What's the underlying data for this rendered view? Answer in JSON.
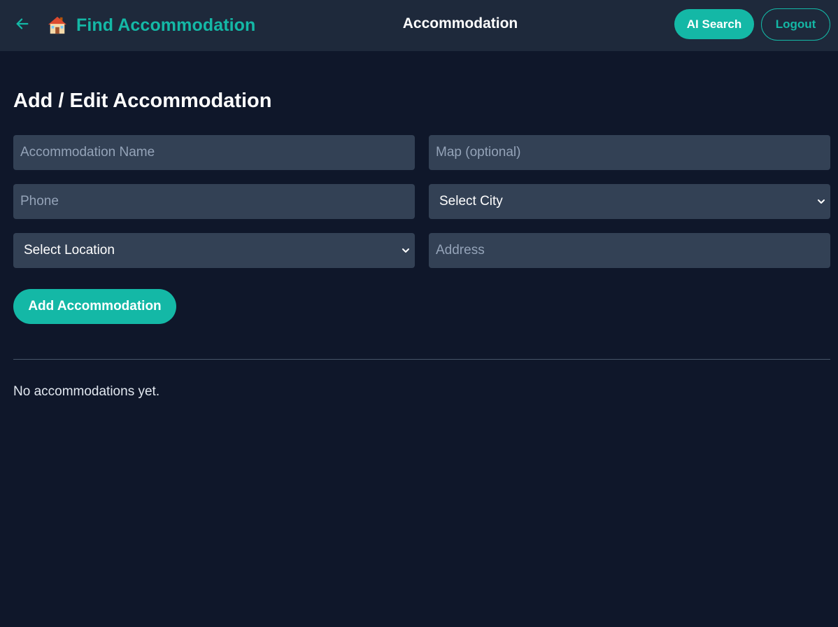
{
  "header": {
    "brand_title": "Find Accommodation",
    "page_title": "Accommodation",
    "ai_search_label": "AI Search",
    "logout_label": "Logout",
    "brand_icon": "house-icon",
    "back_icon": "arrow-left-icon"
  },
  "form": {
    "heading": "Add / Edit Accommodation",
    "name_placeholder": "Accommodation Name",
    "map_placeholder": "Map (optional)",
    "phone_placeholder": "Phone",
    "city_selected": "Select City",
    "location_selected": "Select Location",
    "address_placeholder": "Address",
    "submit_label": "Add Accommodation"
  },
  "list": {
    "empty_message": "No accommodations yet."
  },
  "colors": {
    "accent": "#14b8a6",
    "background": "#0f172a",
    "header_bg": "#1e293b",
    "field_bg": "#334155"
  }
}
